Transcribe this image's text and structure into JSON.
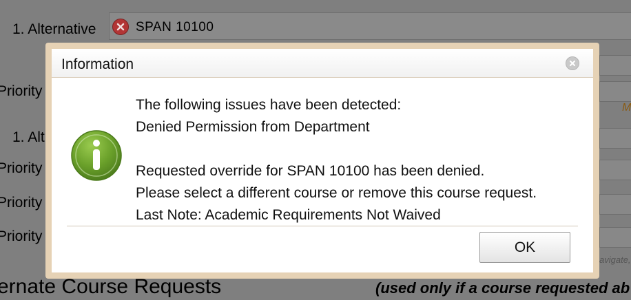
{
  "background": {
    "alternative_label": "1. Alternative",
    "alternative_value": "SPAN 10100",
    "priority_labels": [
      "Priority",
      "Priority",
      "Priority",
      "Priority"
    ],
    "alt_partial_label": "1. Alt",
    "orange_fragment": "M",
    "small_fragment": "avigate,",
    "section_heading": "ernate Course Requests",
    "section_note": "(used only if a course requested ab"
  },
  "dialog": {
    "title": "Information",
    "lines": [
      "The following issues have been detected:",
      "Denied Permission from Department",
      "",
      "Requested override for SPAN 10100 has been denied.",
      "Please select a different course or remove this course request.",
      "Last Note: Academic Requirements Not Waived"
    ],
    "ok_label": "OK",
    "icons": {
      "close": "close-icon",
      "info": "info-icon",
      "remove": "remove-icon"
    },
    "colors": {
      "info_green": "#6aa02a",
      "frame": "#e6d2b5"
    }
  }
}
